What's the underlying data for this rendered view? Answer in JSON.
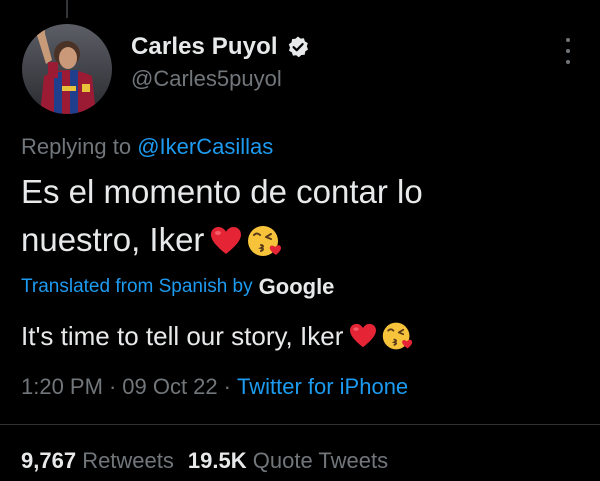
{
  "author": {
    "display_name": "Carles Puyol",
    "handle": "@Carles5puyol",
    "verified": true
  },
  "reply": {
    "prefix": "Replying to",
    "mention": "@IkerCasillas"
  },
  "tweet": {
    "line1": "Es el momento de contar lo",
    "line2": "nuestro, Iker"
  },
  "translation": {
    "label": "Translated from Spanish by",
    "provider": "Google",
    "text": "It's time to tell our story, Iker"
  },
  "meta": {
    "time": "1:20 PM",
    "separator": "·",
    "date": "09 Oct 22",
    "source": "Twitter for iPhone"
  },
  "stats": {
    "retweets_count": "9,767",
    "retweets_label": "Retweets",
    "quotes_count": "19.5K",
    "quotes_label": "Quote Tweets"
  },
  "icons": {
    "verified": "verified-badge-icon",
    "more": "more-options-icon",
    "heart_emoji": "red-heart-emoji",
    "kiss_emoji": "face-blowing-kiss-emoji"
  },
  "colors": {
    "background": "#000000",
    "text": "#e7e9ea",
    "muted": "#71767b",
    "accent": "#1d9bf0"
  }
}
